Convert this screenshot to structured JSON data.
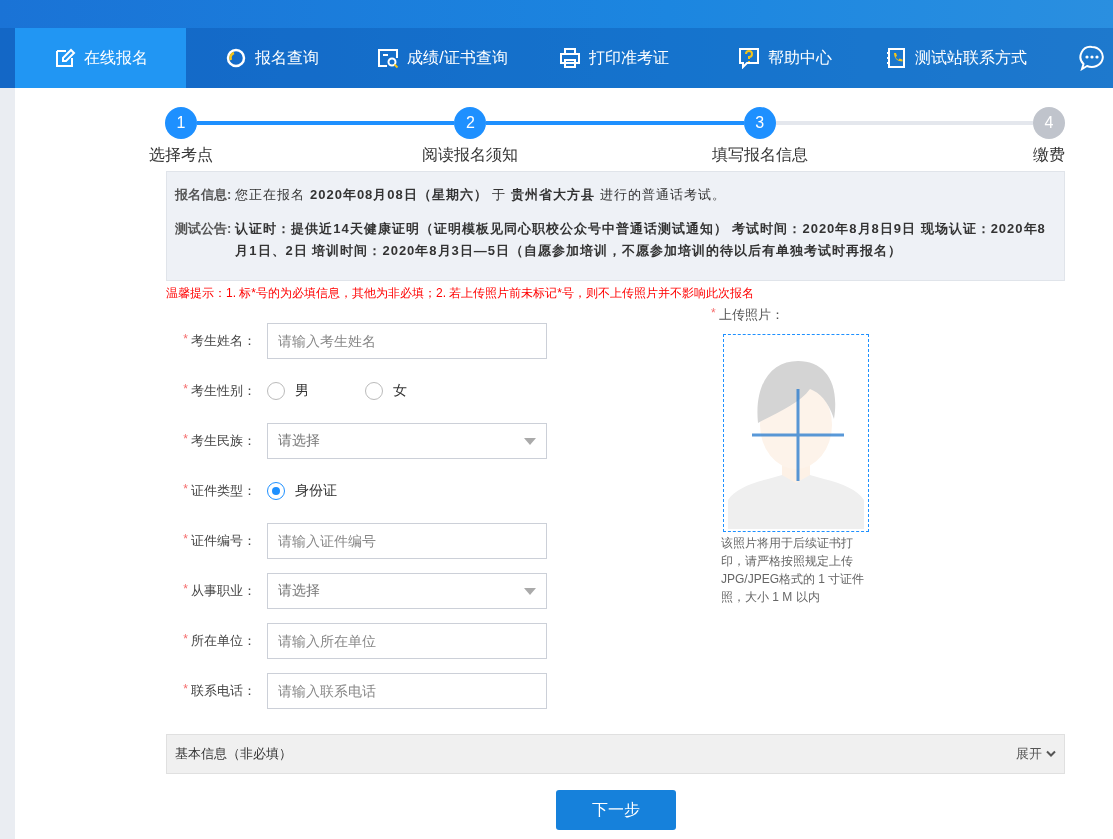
{
  "nav": {
    "tabs": [
      {
        "label": "在线报名",
        "selected": true
      },
      {
        "label": "报名查询",
        "selected": false
      },
      {
        "label": "成绩/证书查询",
        "selected": false
      },
      {
        "label": "打印准考证",
        "selected": false
      },
      {
        "label": "帮助中心",
        "selected": false
      },
      {
        "label": "测试站联系方式",
        "selected": false
      }
    ]
  },
  "steps": [
    {
      "number": "1",
      "label": "选择考点",
      "completed": true
    },
    {
      "number": "2",
      "label": "阅读报名须知",
      "completed": true
    },
    {
      "number": "3",
      "label": "填写报名信息",
      "completed": true
    },
    {
      "number": "4",
      "label": "缴费",
      "completed": false
    }
  ],
  "info": [
    {
      "label": "报名信息:",
      "text": "您正在报名 **2020年08月08日（星期六）** 于 **贵州省大方县** 进行的普通话考试。"
    },
    {
      "label": "测试公告:",
      "text": "**认证时：提供近14天健康证明（证明模板见同心职校公众号中普通话测试通知） 考试时间：2020年8月8日9日 现场认证：2020年8月1日、2日 培训时间：2020年8月3日—5日（自愿参加培训，不愿参加培训的待以后有单独考试时再报名）**"
    }
  ],
  "tip": "温馨提示：1. 标*号的为必填信息，其他为非必填；2. 若上传照片前未标记*号，则不上传照片并不影响此次报名",
  "fields": [
    {
      "asterisk": "*",
      "label": "考生姓名：",
      "kind": "text",
      "placeholder": "请输入考生姓名"
    },
    {
      "asterisk": "*",
      "label": "考生性别：",
      "kind": "radio",
      "options": [
        {
          "label": "男",
          "selected": false
        },
        {
          "label": "女",
          "selected": false
        }
      ]
    },
    {
      "asterisk": "*",
      "label": "考生民族：",
      "kind": "select",
      "placeholder": "请选择"
    },
    {
      "asterisk": "*",
      "label": "证件类型：",
      "kind": "radio",
      "options": [
        {
          "label": "身份证",
          "selected": true
        }
      ]
    },
    {
      "asterisk": "*",
      "label": "证件编号：",
      "kind": "text",
      "placeholder": "请输入证件编号"
    },
    {
      "asterisk": "*",
      "label": "从事职业：",
      "kind": "select",
      "placeholder": "请选择"
    },
    {
      "asterisk": "*",
      "label": "所在单位：",
      "kind": "text",
      "placeholder": "请输入所在单位"
    },
    {
      "asterisk": "*",
      "label": "联系电话：",
      "kind": "text",
      "placeholder": "请输入联系电话"
    }
  ],
  "photo": {
    "asterisk": "*",
    "label": "上传照片：",
    "caption": "该照片将用于后续证书打印，请严格按照规定上传JPG/JPEG格式的 1 寸证件照，大小 1 M 以内"
  },
  "optional_section": {
    "title": "基本信息（非必填）",
    "toggle": "展开",
    "expanded": false
  },
  "next_button": "下一步"
}
